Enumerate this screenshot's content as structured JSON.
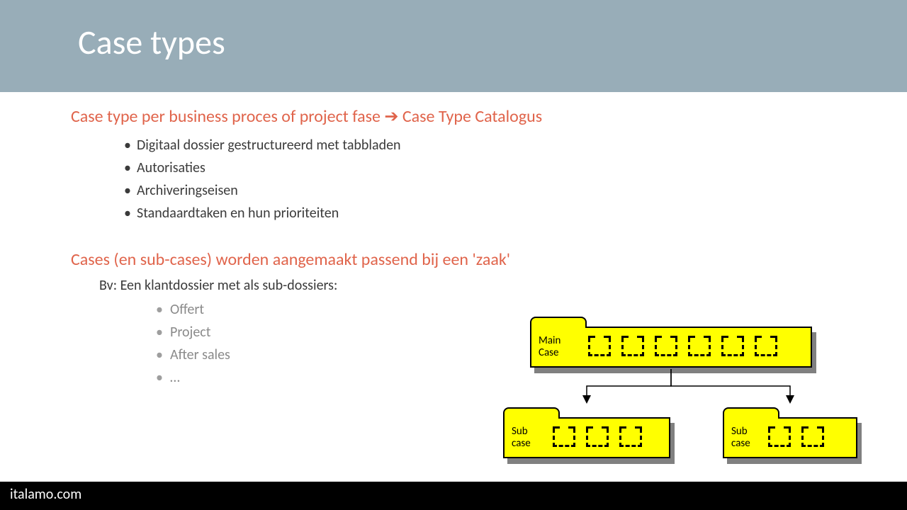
{
  "header": {
    "title": "Case types"
  },
  "section1": {
    "heading": "Case type per business proces of project fase ➔ Case Type Catalogus",
    "items": [
      "Digitaal dossier gestructureerd met tabbladen",
      "Autorisaties",
      "Archiveringseisen",
      "Standaardtaken en hun prioriteiten"
    ]
  },
  "section2": {
    "heading": "Cases (en sub-cases) worden aangemaakt passend bij een 'zaak'",
    "intro": "Bv: Een klantdossier met als sub-dossiers:",
    "items": [
      "Offert",
      "Project",
      "After sales",
      "…"
    ]
  },
  "diagram": {
    "main_label": "Main\nCase",
    "sub1_label": "Sub\ncase",
    "sub2_label": "Sub\ncase"
  },
  "footer": {
    "text": "italamo.com"
  }
}
